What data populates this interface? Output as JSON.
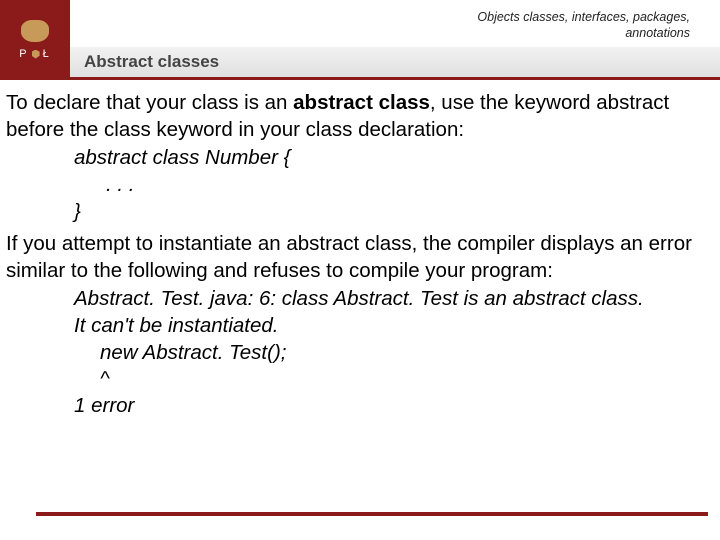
{
  "header": {
    "breadcrumb_line1": "Objects classes, interfaces, packages,",
    "breadcrumb_line2": "annotations",
    "logo_left": "P",
    "logo_right": "Ł",
    "title": "Abstract classes"
  },
  "body": {
    "p1_a": "To declare that your class is an ",
    "p1_b": "abstract class",
    "p1_c": ", use the keyword abstract before the class keyword in your class declaration:",
    "code1": "abstract class Number {",
    "code2": ". . .",
    "code3": "}",
    "p2": "If you attempt to instantiate an abstract class, the compiler displays an error similar to the following and refuses to compile your program:",
    "err1": "Abstract. Test. java: 6: class Abstract. Test is an abstract class.",
    "err2": "It can't be instantiated.",
    "err3": "new Abstract. Test();",
    "err4": "^",
    "err5": "1 error"
  }
}
